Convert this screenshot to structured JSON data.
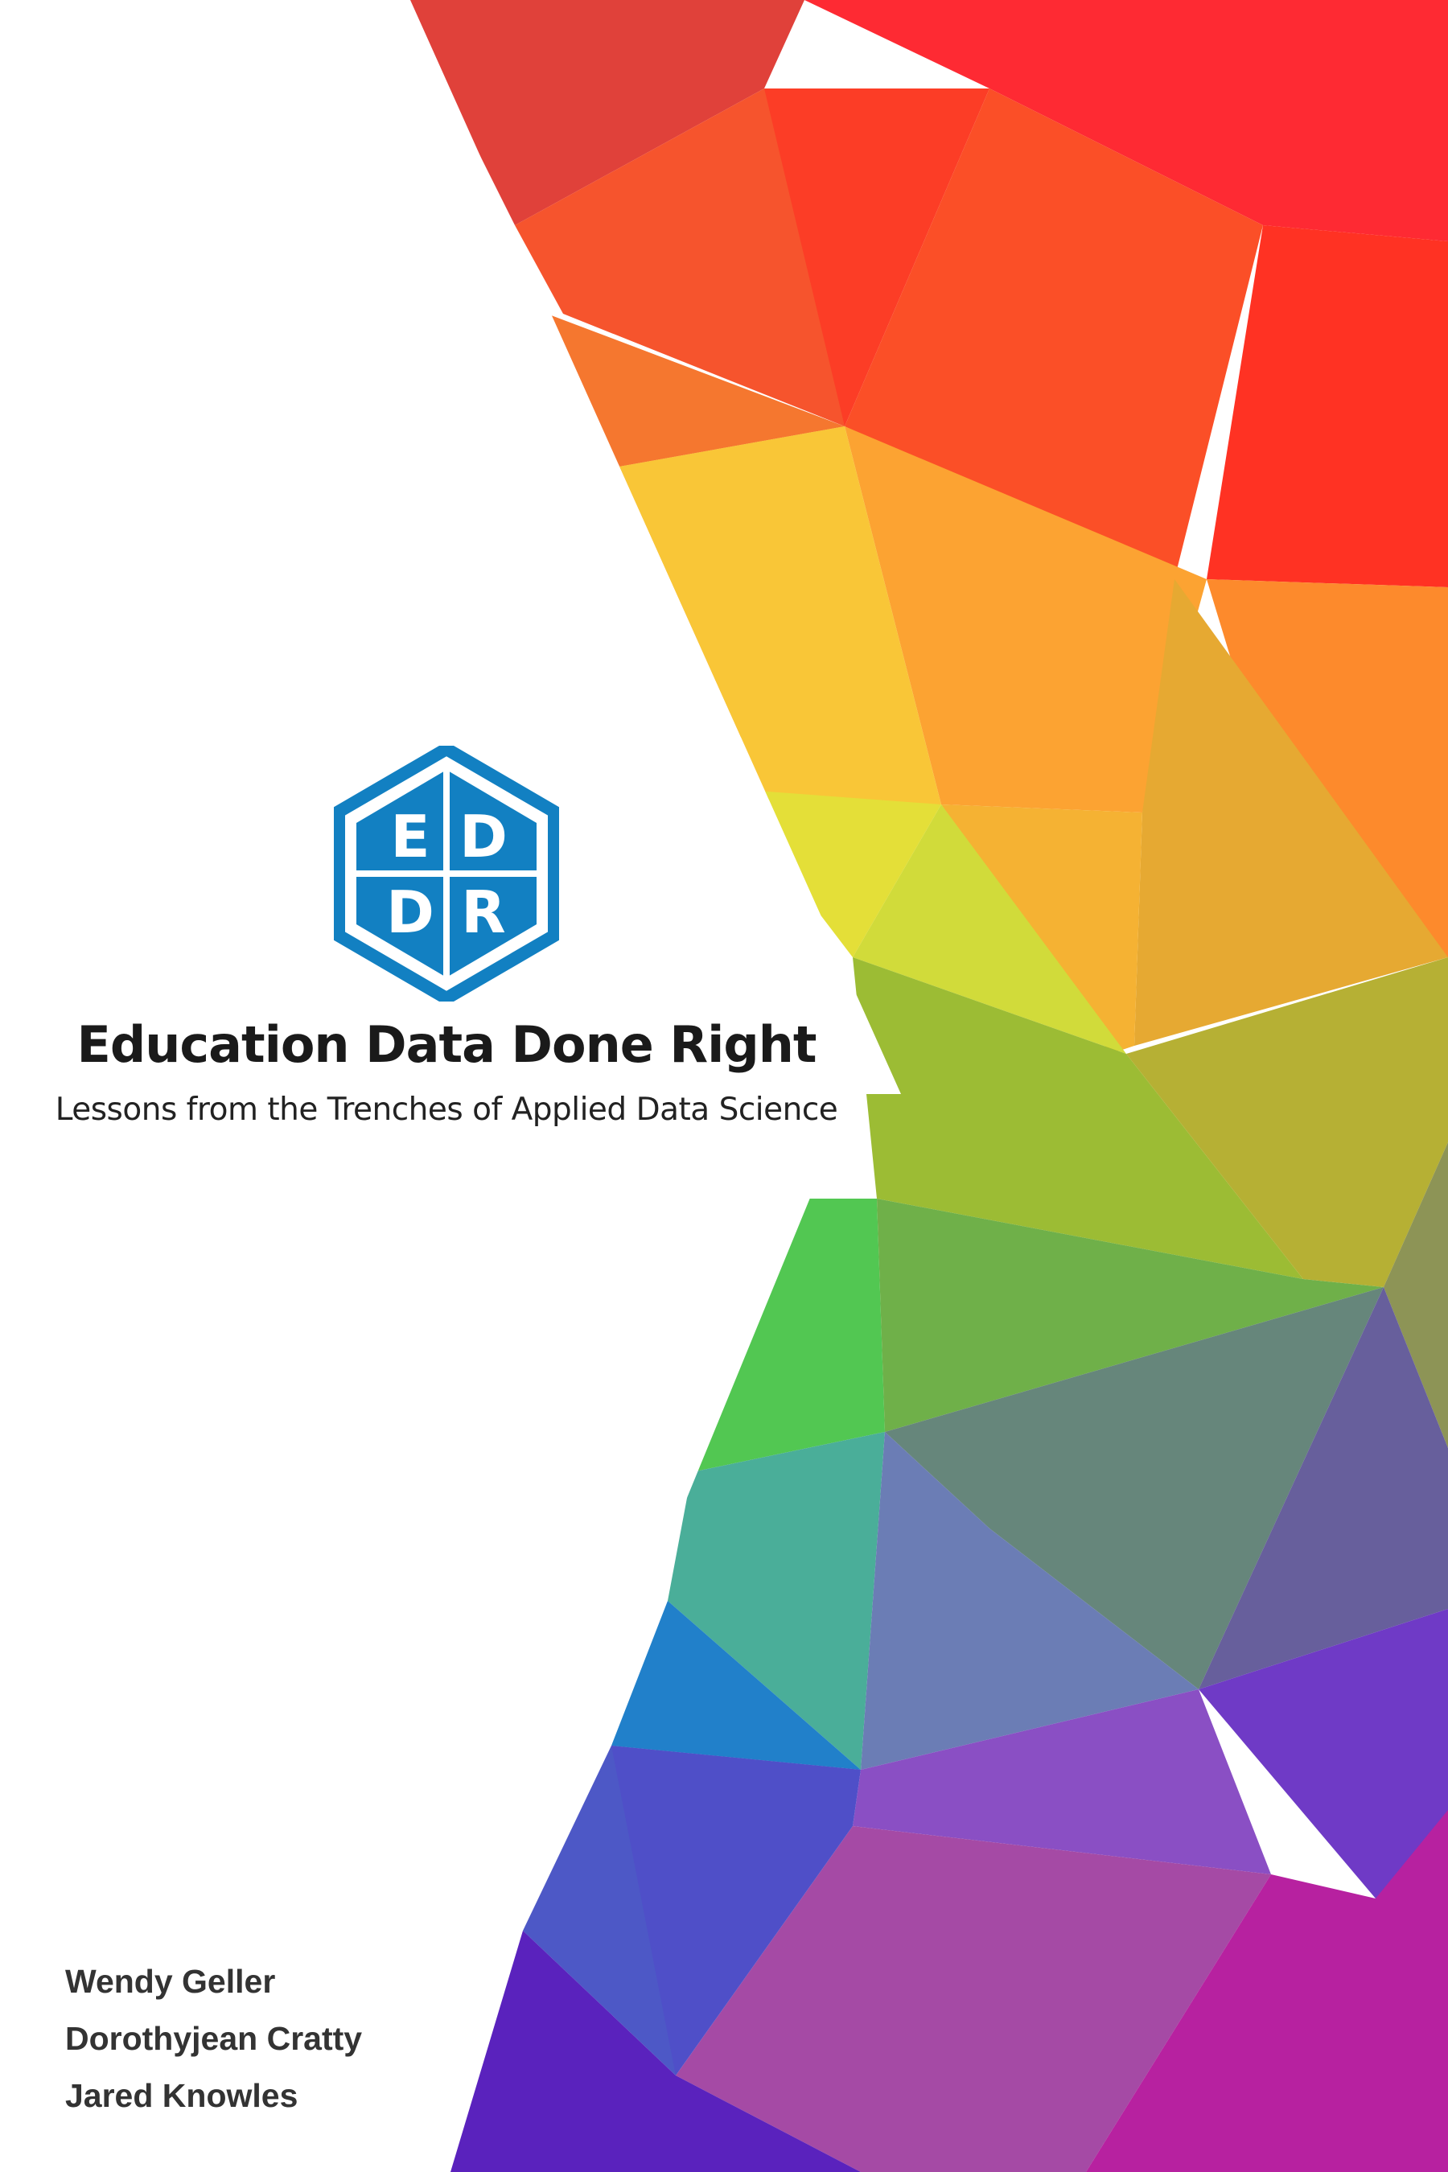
{
  "cover": {
    "logo": {
      "letters": [
        "E",
        "D",
        "D",
        "R"
      ],
      "color": "#1280c2"
    },
    "title": "Education Data Done Right",
    "subtitle": "Lessons from the Trenches of Applied Data Science",
    "authors": [
      "Wendy Geller",
      "Dorothyjean Cratty",
      "Jared Knowles"
    ],
    "art": {
      "description_colors": [
        "#e23a2e",
        "#ff2d2b",
        "#f6502c",
        "#f7792c",
        "#fcb030",
        "#f9c234",
        "#e5df36",
        "#9dbe32",
        "#4fc64b",
        "#6cb04a",
        "#4aab99",
        "#6a85b0",
        "#2d80c9",
        "#5052c4",
        "#7b3ec4",
        "#b52aa0",
        "#c4158a"
      ]
    }
  }
}
